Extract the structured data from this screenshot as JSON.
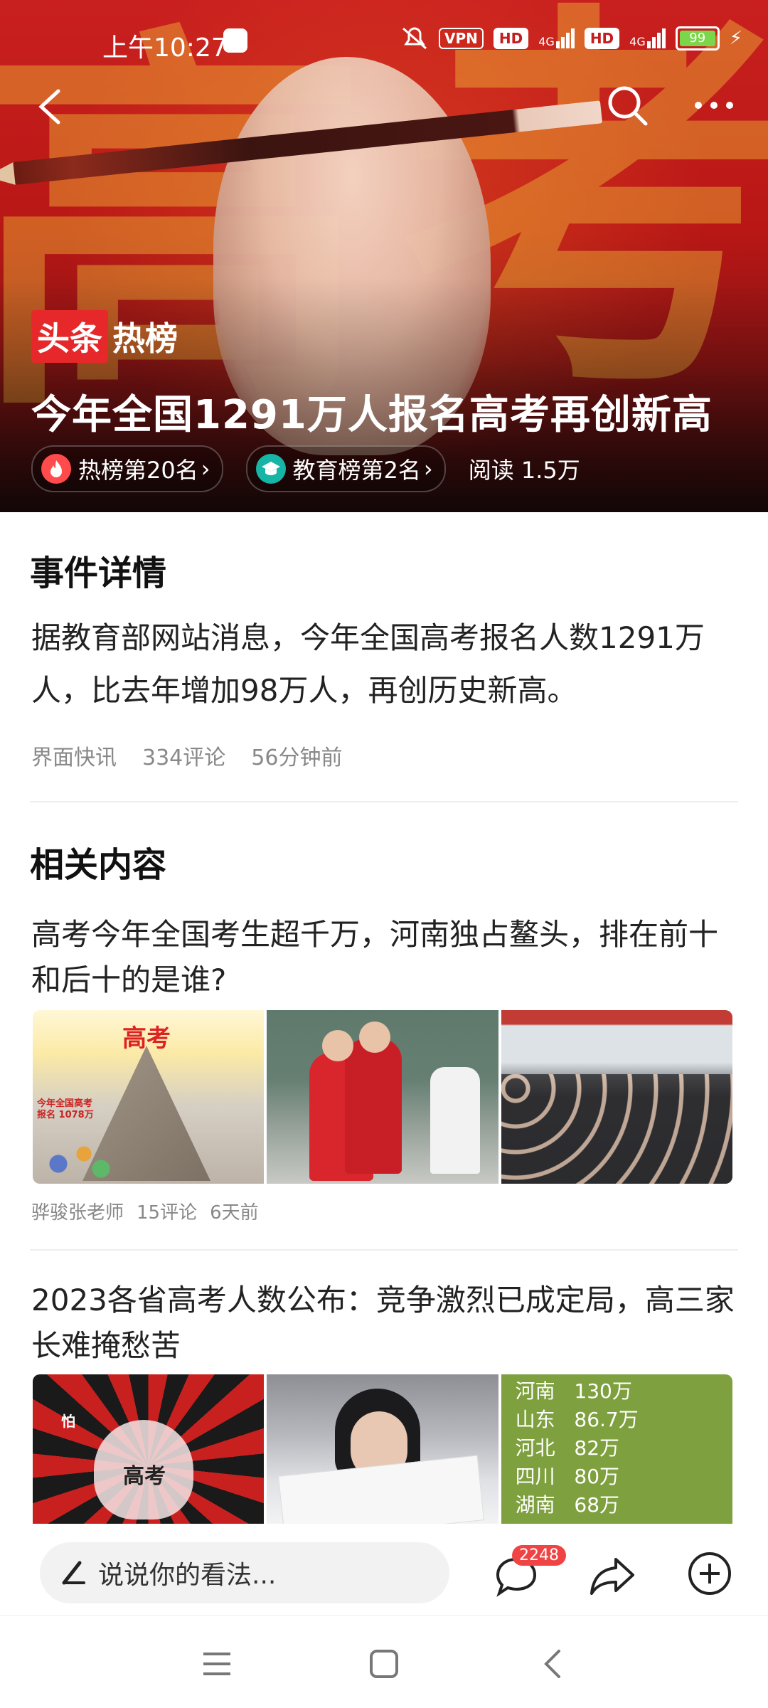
{
  "status": {
    "time": "上午10:27",
    "vpn": "VPN",
    "hd1": "HD",
    "net1": "4G",
    "hd2": "HD",
    "net2": "4G",
    "battery": "99"
  },
  "hero": {
    "brand_left": "头条",
    "brand_right": "热榜",
    "title": "今年全国1291万人报名高考再创新高",
    "chip_hot": "热榜第20名",
    "chip_edu": "教育榜第2名",
    "reads": "阅读 1.5万",
    "bg_char_1": "高",
    "bg_char_2": "考"
  },
  "details": {
    "heading": "事件详情",
    "body": "据教育部网站消息，今年全国高考报名人数1291万人，比去年增加98万人，再创历史新高。",
    "source": "界面快讯",
    "comments": "334评论",
    "time": "56分钟前"
  },
  "related": {
    "heading": "相关内容",
    "items": [
      {
        "title": "高考今年全国考生超千万，河南独占鳌头，排在前十和后十的是谁?",
        "author": "骅骏张老师",
        "comments": "15评论",
        "time": "6天前",
        "thumb1_text": "高考",
        "thumb1_caption": "今年全国高考报名 1078万"
      },
      {
        "title": "2023各省高考人数公布：竞争激烈已成定局，高三家长难掩愁苦",
        "thumb1_text": "高考",
        "thumb1_small": "怕",
        "stats": [
          {
            "province": "河南",
            "value": "130万"
          },
          {
            "province": "山东",
            "value": "86.7万"
          },
          {
            "province": "河北",
            "value": "82万"
          },
          {
            "province": "四川",
            "value": "80万"
          },
          {
            "province": "湖南",
            "value": "68万"
          }
        ]
      }
    ]
  },
  "bottom": {
    "comment_placeholder": "说说你的看法...",
    "comment_count": "2248"
  },
  "icons": {
    "back": "back-arrow-icon",
    "search": "search-icon",
    "more": "more-icon",
    "fire": "fire-icon",
    "edu": "graduation-cap-icon",
    "comment": "comment-icon",
    "share": "share-icon",
    "add": "add-icon",
    "pen": "pen-icon"
  },
  "colors": {
    "brand_red": "#e7282a",
    "hot_red": "#ff4b4b",
    "edu_teal": "#17b5a5",
    "badge_red": "#f04444"
  }
}
